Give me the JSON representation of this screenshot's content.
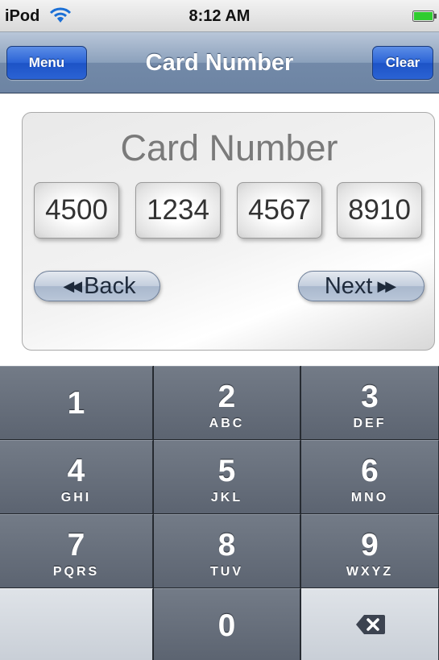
{
  "status_bar": {
    "carrier": "iPod",
    "time": "8:12 AM",
    "wifi_icon": "wifi-icon",
    "battery_icon": "battery-icon",
    "battery_color": "#2fcc2f"
  },
  "nav_bar": {
    "title": "Card Number",
    "menu_label": "Menu",
    "clear_label": "Clear",
    "button_color": "#2a63d6"
  },
  "panel": {
    "title": "Card Number",
    "digits": [
      "4500",
      "1234",
      "4567",
      "8910"
    ],
    "back_label": "Back",
    "next_label": "Next",
    "back_icon": "double-left-arrow-icon",
    "next_icon": "double-right-arrow-icon"
  },
  "keypad": {
    "keys": [
      {
        "num": "1",
        "letters": ""
      },
      {
        "num": "2",
        "letters": "ABC"
      },
      {
        "num": "3",
        "letters": "DEF"
      },
      {
        "num": "4",
        "letters": "GHI"
      },
      {
        "num": "5",
        "letters": "JKL"
      },
      {
        "num": "6",
        "letters": "MNO"
      },
      {
        "num": "7",
        "letters": "PQRS"
      },
      {
        "num": "8",
        "letters": "TUV"
      },
      {
        "num": "9",
        "letters": "WXYZ"
      },
      {
        "num": "0",
        "letters": ""
      }
    ],
    "delete_icon": "backspace-icon"
  }
}
